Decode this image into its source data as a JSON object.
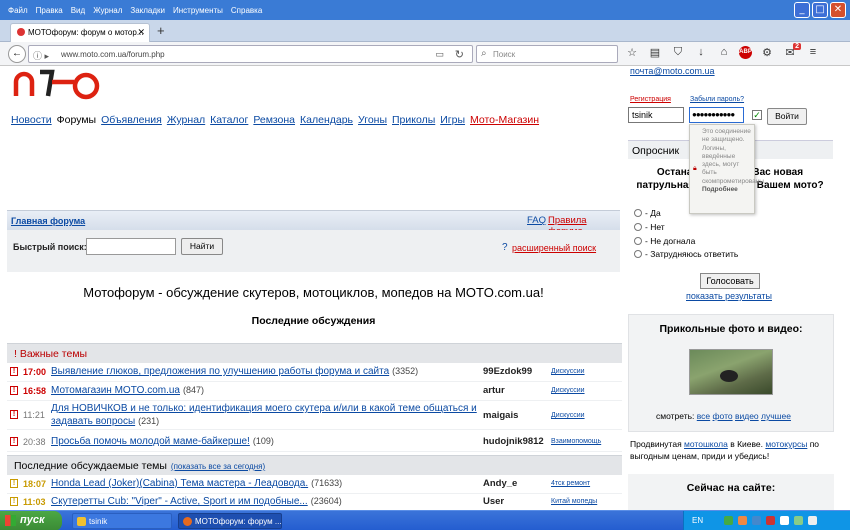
{
  "browser": {
    "menu": [
      "Файл",
      "Правка",
      "Вид",
      "Журнал",
      "Закладки",
      "Инструменты",
      "Справка"
    ],
    "tab_title": "МОТОфорум: форум о мотор...",
    "url": "www.moto.com.ua/forum.php",
    "search_placeholder": "Поиск",
    "notifications_count": "2"
  },
  "site": {
    "email_partial": "почта@moto.com.ua",
    "nav": [
      {
        "label": "Новости"
      },
      {
        "label": "Форумы",
        "current": true
      },
      {
        "label": "Объявления"
      },
      {
        "label": "Журнал"
      },
      {
        "label": "Каталог"
      },
      {
        "label": "Ремзона"
      },
      {
        "label": "Календарь"
      },
      {
        "label": "Угоны"
      },
      {
        "label": "Приколы"
      },
      {
        "label": "Игры"
      },
      {
        "label": "Мото-Магазин",
        "highlight": true
      }
    ]
  },
  "forum": {
    "home_link": "Главная форума",
    "faq": "FAQ",
    "rules": "Правила форума",
    "quick_search_label": "Быстрый поиск:",
    "quick_search_value": "",
    "find_button": "Найти",
    "adv_search_q": "?",
    "adv_search": "расширенный поиск",
    "title": "Мотофорум - обсуждение скутеров, мотоциклов, мопедов на MOTO.com.ua!",
    "latest_heading": "Последние обсуждения",
    "important_heading": "! Важные темы",
    "important": [
      {
        "time": "17:00",
        "title": "Выявление глюков, предложения по улучшению работы форума и сайта",
        "count": "(3352)",
        "author": "99Ezdok99",
        "cat": "Дискуссии"
      },
      {
        "time": "16:58",
        "title": "Мотомагазин MOTO.com.ua",
        "count": "(847)",
        "author": "artur",
        "cat": "Дискуссии"
      },
      {
        "time": "11:21",
        "title": "Для НОВИЧКОВ и не только: идентификация моего скутера и/или в какой теме общаться и задавать вопросы",
        "count": "(231)",
        "author": "maigais",
        "cat": "Дискуссии"
      },
      {
        "time": "20:38",
        "title": "Просьба помочь молодой маме-байкерше!",
        "count": "(109)",
        "author": "hudojnik9812",
        "cat": "Взаимопомощь"
      }
    ],
    "recent_heading": "Последние обсуждаемые темы",
    "recent_show_all": "(показать все за сегодня)",
    "recent": [
      {
        "time": "18:07",
        "title": "Honda Lead (Joker)(Cabina) Тема мастера - Леадовода.",
        "count": "(71633)",
        "author": "Andy_e",
        "cat": "4тск ремонт"
      },
      {
        "time": "11:03",
        "title": "Скутеретты Cub: \"Viper\" - Active, Sport и им подобные...",
        "count": "(23604)",
        "author": "User",
        "cat": "Китай мопеды"
      }
    ]
  },
  "sidebar": {
    "register": "Регистрация",
    "forgot": "Забыли пароль?",
    "login_value": "tsinik",
    "password_value": "●●●●●●●●●●●",
    "login_button": "Войти",
    "tooltip_text": "Это соединение не защищено. Логины, введённые здесь, могут быть скомпрометированы.",
    "tooltip_more": "Подробнее",
    "poll_heading": "Опросник",
    "poll_question": "Останавливала ли Вас новая патрульная полиция на Вашем мото?",
    "poll_options": [
      "- Да",
      "- Нет",
      "- Не догнала",
      "- Затрудняюсь ответить"
    ],
    "vote_button": "Голосовать",
    "show_results": "показать результаты",
    "fun_heading": "Прикольные фото и видео:",
    "fun_watch": "смотреть:",
    "fun_links": [
      "все",
      "фото",
      "видео",
      "лучшее"
    ],
    "promo_pre": "Продвинутая ",
    "promo_link1": "мотошкола",
    "promo_mid": " в Киеве. ",
    "promo_link2": "мотокурсы",
    "promo_post": " по выгодным ценам, приди и убедись!",
    "online_heading": "Сейчас на сайте:"
  },
  "taskbar": {
    "start": "пуск",
    "items": [
      "tsinik",
      "МОТОфорум: форум ..."
    ],
    "lang": "EN"
  }
}
